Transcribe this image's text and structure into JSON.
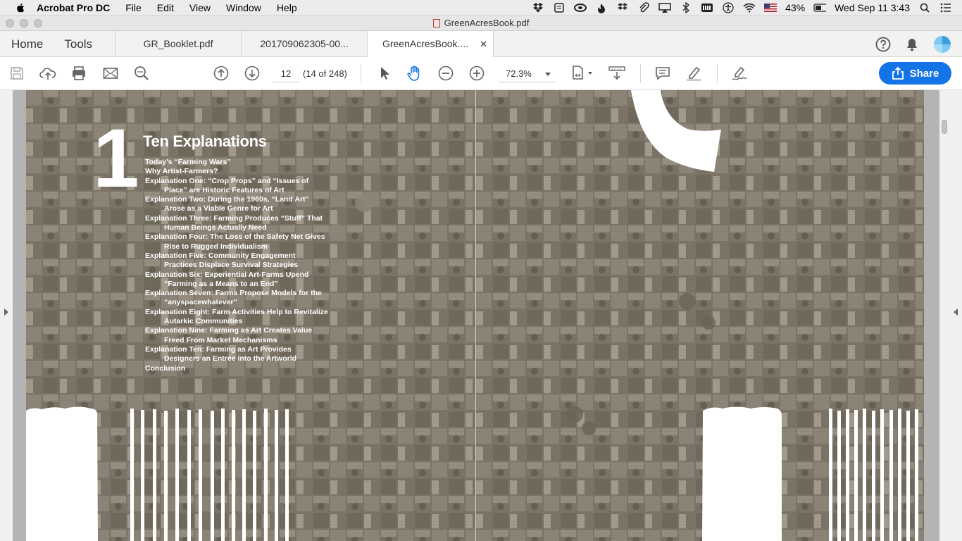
{
  "menubar": {
    "app_name": "Acrobat Pro DC",
    "menus": [
      "File",
      "Edit",
      "View",
      "Window",
      "Help"
    ],
    "battery": "43%",
    "datetime": "Wed Sep 11  3:43"
  },
  "window": {
    "title": "GreenAcresBook.pdf"
  },
  "tabs": {
    "nav": [
      "Home",
      "Tools"
    ],
    "documents": [
      "GR_Booklet.pdf",
      "201709062305-00...",
      "GreenAcresBook...."
    ],
    "active_index": 2,
    "close_glyph": "✕"
  },
  "toolbar": {
    "page_number": "12",
    "page_count": "(14 of 248)",
    "zoom": "72.3%",
    "share_label": "Share"
  },
  "document": {
    "chapter_number": "1",
    "chapter_title": "Ten Explanations",
    "contents": [
      "Today’s “Farming Wars”",
      "Why Artist-Farmers?",
      "Explanation One: “Crop Props” and “Issues of Place” are Historic Features of Art",
      "Explanation Two: During the 1960s, “Land Art” Arose as a Viable Genre for Art",
      "Explanation Three: Farming Produces “Stuff” That Human Beings Actually Need",
      "Explanation Four: The Loss of the Safety Net Gives Rise to Rugged Individualism",
      "Explanation Five: Community Engagement Practices Displace Survival Strategies",
      "Explanation Six: Experiential Art-Farms Upend “Farming as a Means to an End”",
      "Explanation Seven: Farms Propose Models for the “anyspacewhatever”",
      "Explanation Eight: Farm Activities Help to Revitalize Autarkic Communities",
      "Explanation Nine: Farming as Art Creates Value Freed From Market Mechanisms",
      "Explanation Ten: Farming as Art Provides Designers an Entrée into the Artworld",
      "Conclusion"
    ]
  },
  "colors": {
    "share_blue": "#1473e6",
    "page_brown": "#7b7466"
  }
}
